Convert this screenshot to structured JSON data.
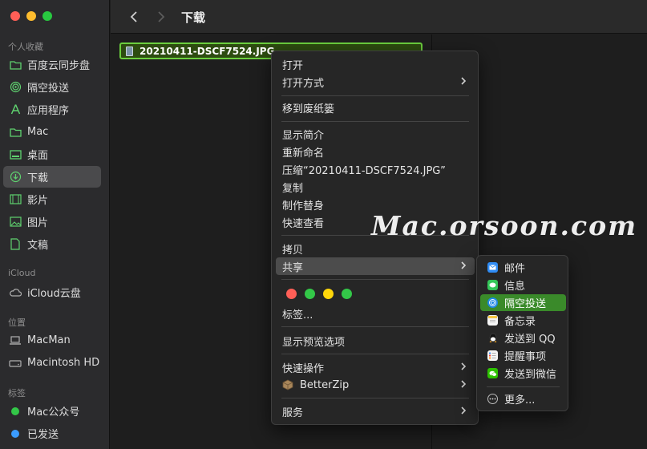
{
  "window": {
    "title": "下载"
  },
  "traffic_lights": {
    "close": "#ff5f57",
    "minimize": "#febc2e",
    "zoom": "#28c840"
  },
  "sidebar": {
    "favorites_title": "个人收藏",
    "favorites": [
      {
        "label": "百度云同步盘",
        "icon": "folder-icon"
      },
      {
        "label": "隔空投送",
        "icon": "airdrop-icon"
      },
      {
        "label": "应用程序",
        "icon": "applications-icon"
      },
      {
        "label": "Mac",
        "icon": "folder-icon"
      },
      {
        "label": "桌面",
        "icon": "desktop-icon"
      },
      {
        "label": "下载",
        "icon": "download-icon",
        "selected": true
      },
      {
        "label": "影片",
        "icon": "movies-icon"
      },
      {
        "label": "图片",
        "icon": "pictures-icon"
      },
      {
        "label": "文稿",
        "icon": "documents-icon"
      }
    ],
    "icloud_title": "iCloud",
    "icloud": [
      {
        "label": "iCloud云盘",
        "icon": "cloud-icon"
      }
    ],
    "locations_title": "位置",
    "locations": [
      {
        "label": "MacMan",
        "icon": "laptop-icon"
      },
      {
        "label": "Macintosh HD",
        "icon": "disk-icon"
      }
    ],
    "tags_title": "标签",
    "tags": [
      {
        "label": "Mac公众号",
        "color": "#33c748"
      },
      {
        "label": "已发送",
        "color": "#3b9cff"
      }
    ]
  },
  "file": {
    "name": "20210411-DSCF7524.JPG"
  },
  "context_menu": {
    "open": "打开",
    "open_with": "打开方式",
    "move_to_trash": "移到废纸篓",
    "get_info": "显示简介",
    "rename": "重新命名",
    "compress": "压缩“20210411-DSCF7524.JPG”",
    "duplicate": "复制",
    "make_alias": "制作替身",
    "quick_look": "快速查看",
    "copy": "拷贝",
    "share": "共享",
    "tag_colors": [
      "#ff5f57",
      "#33c748",
      "#ffd60a",
      "#33c748"
    ],
    "tags": "标签...",
    "show_preview_options": "显示预览选项",
    "quick_actions": "快速操作",
    "betterzip": "BetterZip",
    "services": "服务"
  },
  "share_submenu": {
    "items": [
      {
        "label": "邮件",
        "icon": "mail-icon"
      },
      {
        "label": "信息",
        "icon": "messages-icon"
      },
      {
        "label": "隔空投送",
        "icon": "airdrop-icon",
        "highlighted": true
      },
      {
        "label": "备忘录",
        "icon": "notes-icon"
      },
      {
        "label": "发送到 QQ",
        "icon": "qq-icon"
      },
      {
        "label": "提醒事项",
        "icon": "reminders-icon"
      },
      {
        "label": "发送到微信",
        "icon": "wechat-icon"
      }
    ],
    "more": "更多..."
  },
  "watermark": "Mac.orsoon.com"
}
